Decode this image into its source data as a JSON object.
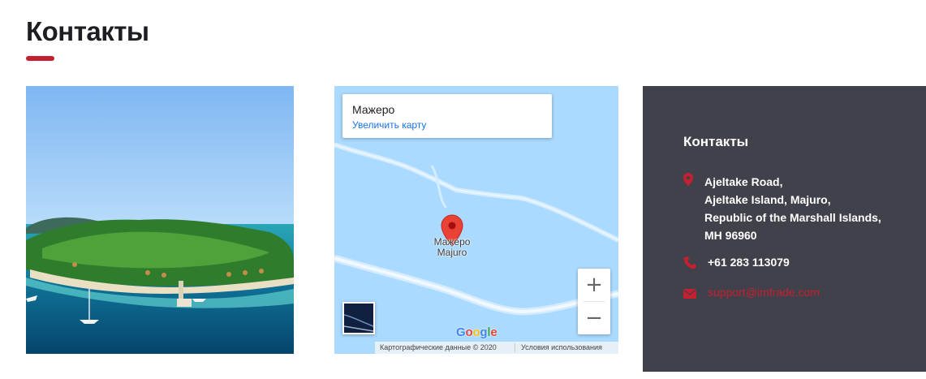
{
  "header": {
    "title": "Контакты",
    "accent_color": "#c4202f"
  },
  "photo": {
    "subject": "tropical island aerial photo"
  },
  "map": {
    "card_title": "Мажеро",
    "card_link": "Увеличить карту",
    "place_label_ru": "Мажеро",
    "place_label_en": "Majuro",
    "zoom_in": "+",
    "zoom_out": "−",
    "google_logo": "Google",
    "attribution_data": "Картографические данные © 2020",
    "attribution_terms": "Условия использования",
    "water_color": "#aadaff",
    "pin_color": "#ea4335"
  },
  "contacts": {
    "heading": "Контакты",
    "address_lines": [
      "Ajeltake Road,",
      "Ajeltake Island, Majuro,",
      "Republic of the Marshall Islands,",
      "MH 96960"
    ],
    "phone": "+61 283 113079",
    "email": "support@imfrade.com",
    "panel_color": "#41414b",
    "icons": [
      "location-pin-icon",
      "phone-icon",
      "envelope-icon"
    ]
  }
}
